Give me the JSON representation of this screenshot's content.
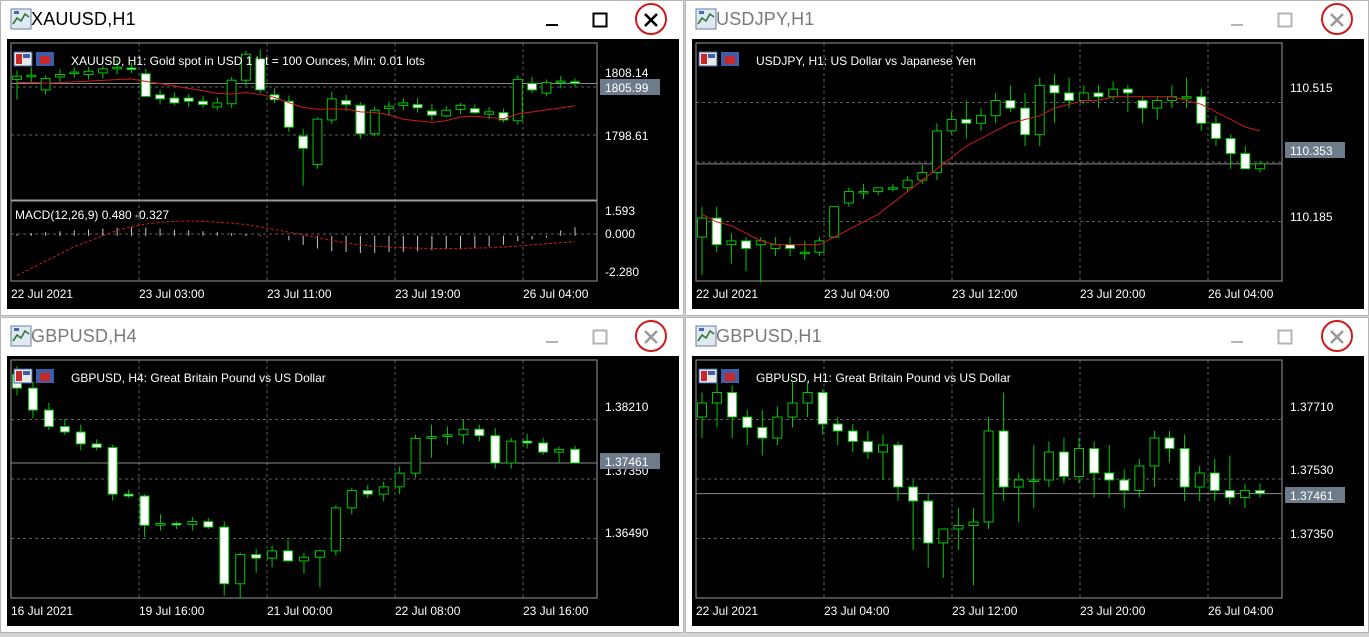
{
  "colors": {
    "chart_bg": "#000000",
    "grid": "#5f5f5f",
    "candle_up": "#00c800",
    "candle_body": "#ffffff",
    "ma_line": "#d01a1a",
    "price_line": "#8c8c8c",
    "price_label_bg": "#6e7b8b",
    "close_ring": "#cc1b1b"
  },
  "icons": {
    "window": "mt4-chart-window-icon",
    "minimize": "minimize-icon",
    "maximize": "maximize-icon",
    "close": "close-icon",
    "chart_badge": "chart-properties-icon"
  },
  "windows": [
    {
      "title": "XAUUSD,H1",
      "active": true,
      "info": "XAUUSD, H1:  Gold spot in USD 1 lot = 100 Ounces, Min: 0.01 lots",
      "price_ticks": [
        "1808.14",
        "1798.61"
      ],
      "current_price": "1805.99",
      "indicator": {
        "label": "MACD(12,26,9) 0.480 -0.327",
        "ticks": [
          "1.593",
          "0.000",
          "-2.280"
        ]
      },
      "time_labels": [
        "22 Jul 2021",
        "23 Jul 03:00",
        "23 Jul 11:00",
        "23 Jul 19:00",
        "26 Jul 04:00"
      ]
    },
    {
      "title": "USDJPY,H1",
      "active": false,
      "info": "USDJPY, H1:  US Dollar vs Japanese Yen",
      "price_ticks": [
        "110.515",
        "110.185"
      ],
      "current_price": "110.353",
      "time_labels": [
        "22 Jul 2021",
        "23 Jul 04:00",
        "23 Jul 12:00",
        "23 Jul 20:00",
        "26 Jul 04:00"
      ]
    },
    {
      "title": "GBPUSD,H4",
      "active": false,
      "info": "GBPUSD, H4:  Great Britain Pound vs US Dollar",
      "price_ticks": [
        "1.38210",
        "1.37350",
        "1.36490"
      ],
      "current_price": "1.37461",
      "time_labels": [
        "16 Jul 2021",
        "19 Jul 16:00",
        "21 Jul 00:00",
        "22 Jul 08:00",
        "23 Jul 16:00"
      ]
    },
    {
      "title": "GBPUSD,H1",
      "active": false,
      "info": "GBPUSD, H1:  Great Britain Pound vs US Dollar",
      "price_ticks": [
        "1.37710",
        "1.37530",
        "1.37350"
      ],
      "current_price": "1.37461",
      "time_labels": [
        "22 Jul 2021",
        "23 Jul 04:00",
        "23 Jul 12:00",
        "23 Jul 20:00",
        "26 Jul 04:00"
      ]
    }
  ],
  "chart_data": [
    {
      "type": "candlestick",
      "symbol": "XAUUSD",
      "timeframe": "H1",
      "ylim": [
        1792,
        1810
      ],
      "ma_period_hint": "moving-average",
      "candles": [
        [
          1806.5,
          1807.6,
          1804.0,
          1806.9
        ],
        [
          1807.0,
          1808.0,
          1806.0,
          1807.0
        ],
        [
          1805.2,
          1807.0,
          1804.6,
          1806.6
        ],
        [
          1806.8,
          1807.8,
          1806.2,
          1807.1
        ],
        [
          1807.3,
          1808.0,
          1806.7,
          1807.4
        ],
        [
          1807.1,
          1808.0,
          1806.5,
          1807.5
        ],
        [
          1807.3,
          1808.2,
          1806.6,
          1807.8
        ],
        [
          1807.8,
          1808.9,
          1807.1,
          1808.0
        ],
        [
          1807.9,
          1808.6,
          1807.3,
          1807.8
        ],
        [
          1807.2,
          1807.8,
          1805.4,
          1804.4
        ],
        [
          1804.6,
          1805.2,
          1803.4,
          1804.1
        ],
        [
          1804.2,
          1804.9,
          1803.3,
          1803.6
        ],
        [
          1804.2,
          1804.7,
          1803.1,
          1803.8
        ],
        [
          1803.8,
          1804.5,
          1803.0,
          1803.4
        ],
        [
          1803.1,
          1804.3,
          1802.7,
          1803.6
        ],
        [
          1803.5,
          1806.8,
          1803.0,
          1806.4
        ],
        [
          1806.4,
          1810.0,
          1805.7,
          1809.6
        ],
        [
          1809.0,
          1810.2,
          1804.8,
          1805.2
        ],
        [
          1804.6,
          1805.4,
          1803.6,
          1804.0
        ],
        [
          1803.8,
          1804.5,
          1800.0,
          1800.6
        ],
        [
          1799.5,
          1800.4,
          1793.4,
          1798.0
        ],
        [
          1796.0,
          1801.8,
          1795.5,
          1801.6
        ],
        [
          1801.5,
          1805.0,
          1801.0,
          1804.1
        ],
        [
          1803.9,
          1804.6,
          1802.6,
          1803.4
        ],
        [
          1803.3,
          1803.7,
          1799.2,
          1799.8
        ],
        [
          1799.8,
          1803.2,
          1799.5,
          1802.7
        ],
        [
          1802.9,
          1803.8,
          1802.0,
          1803.2
        ],
        [
          1803.3,
          1804.2,
          1802.7,
          1803.6
        ],
        [
          1803.4,
          1804.2,
          1802.4,
          1803.0
        ],
        [
          1802.6,
          1803.5,
          1801.4,
          1802.1
        ],
        [
          1802.0,
          1803.2,
          1801.8,
          1802.7
        ],
        [
          1802.8,
          1803.6,
          1802.2,
          1803.3
        ],
        [
          1802.9,
          1803.4,
          1802.2,
          1802.4
        ],
        [
          1802.2,
          1803.1,
          1801.6,
          1802.5
        ],
        [
          1802.4,
          1802.9,
          1801.2,
          1801.5
        ],
        [
          1801.4,
          1807.0,
          1800.9,
          1806.5
        ],
        [
          1806.0,
          1806.8,
          1804.8,
          1805.2
        ],
        [
          1804.8,
          1806.5,
          1804.4,
          1806.1
        ],
        [
          1806.1,
          1806.9,
          1805.4,
          1806.3
        ],
        [
          1806.2,
          1806.6,
          1805.6,
          1805.99
        ]
      ],
      "macd": {
        "ylim": [
          -2.28,
          1.593
        ],
        "hist": [
          0.1,
          0.15,
          0.2,
          0.25,
          0.3,
          0.35,
          0.4,
          0.45,
          0.48,
          0.45,
          0.4,
          0.35,
          0.3,
          0.25,
          0.2,
          0.15,
          0.1,
          0.05,
          0.0,
          -0.25,
          -0.5,
          -0.7,
          -0.85,
          -0.9,
          -0.95,
          -0.95,
          -0.9,
          -0.9,
          -0.85,
          -0.8,
          -0.75,
          -0.75,
          -0.7,
          -0.6,
          -0.5,
          -0.3,
          -0.2,
          -0.1,
          0.3,
          0.48
        ],
        "signal": [
          -2.2,
          -1.8,
          -1.4,
          -1.0,
          -0.6,
          -0.3,
          0.0,
          0.3,
          0.5,
          0.65,
          0.75,
          0.8,
          0.82,
          0.8,
          0.75,
          0.7,
          0.62,
          0.5,
          0.35,
          0.2,
          0.05,
          -0.1,
          -0.25,
          -0.4,
          -0.5,
          -0.58,
          -0.62,
          -0.66,
          -0.68,
          -0.7,
          -0.7,
          -0.7,
          -0.68,
          -0.66,
          -0.62,
          -0.58,
          -0.5,
          -0.44,
          -0.38,
          -0.327
        ]
      }
    },
    {
      "type": "candlestick",
      "symbol": "USDJPY",
      "timeframe": "H1",
      "ylim": [
        110.06,
        110.64
      ],
      "candles": [
        [
          110.16,
          110.24,
          110.06,
          110.21
        ],
        [
          110.21,
          110.24,
          110.12,
          110.14
        ],
        [
          110.14,
          110.17,
          110.09,
          110.15
        ],
        [
          110.15,
          110.16,
          110.07,
          110.13
        ],
        [
          110.14,
          110.16,
          110.04,
          110.15
        ],
        [
          110.13,
          110.16,
          110.11,
          110.14
        ],
        [
          110.14,
          110.16,
          110.11,
          110.13
        ],
        [
          110.12,
          110.15,
          110.1,
          110.12
        ],
        [
          110.12,
          110.16,
          110.11,
          110.15
        ],
        [
          110.16,
          110.24,
          110.16,
          110.24
        ],
        [
          110.25,
          110.29,
          110.24,
          110.28
        ],
        [
          110.28,
          110.3,
          110.26,
          110.28
        ],
        [
          110.28,
          110.29,
          110.27,
          110.29
        ],
        [
          110.29,
          110.3,
          110.28,
          110.29
        ],
        [
          110.29,
          110.32,
          110.28,
          110.31
        ],
        [
          110.31,
          110.35,
          110.3,
          110.33
        ],
        [
          110.33,
          110.46,
          110.31,
          110.44
        ],
        [
          110.44,
          110.49,
          110.43,
          110.47
        ],
        [
          110.47,
          110.52,
          110.42,
          110.46
        ],
        [
          110.46,
          110.5,
          110.44,
          110.48
        ],
        [
          110.48,
          110.54,
          110.46,
          110.52
        ],
        [
          110.52,
          110.56,
          110.49,
          110.5
        ],
        [
          110.5,
          110.54,
          110.4,
          110.43
        ],
        [
          110.43,
          110.58,
          110.4,
          110.56
        ],
        [
          110.56,
          110.59,
          110.46,
          110.54
        ],
        [
          110.54,
          110.58,
          110.5,
          110.52
        ],
        [
          110.52,
          110.56,
          110.51,
          110.54
        ],
        [
          110.54,
          110.56,
          110.5,
          110.53
        ],
        [
          110.53,
          110.57,
          110.52,
          110.55
        ],
        [
          110.55,
          110.56,
          110.49,
          110.54
        ],
        [
          110.52,
          110.53,
          110.46,
          110.5
        ],
        [
          110.5,
          110.53,
          110.47,
          110.52
        ],
        [
          110.52,
          110.56,
          110.5,
          110.53
        ],
        [
          110.53,
          110.58,
          110.5,
          110.53
        ],
        [
          110.53,
          110.55,
          110.44,
          110.46
        ],
        [
          110.46,
          110.48,
          110.4,
          110.42
        ],
        [
          110.42,
          110.43,
          110.34,
          110.38
        ],
        [
          110.38,
          110.4,
          110.34,
          110.34
        ],
        [
          110.34,
          110.36,
          110.33,
          110.353
        ]
      ],
      "ma": [
        110.22,
        110.2,
        110.19,
        110.17,
        110.15,
        110.14,
        110.14,
        110.14,
        110.14,
        110.16,
        110.18,
        110.2,
        110.22,
        110.25,
        110.28,
        110.31,
        110.34,
        110.37,
        110.4,
        110.42,
        110.44,
        110.46,
        110.47,
        110.48,
        110.5,
        110.51,
        110.52,
        110.52,
        110.53,
        110.53,
        110.53,
        110.53,
        110.53,
        110.52,
        110.51,
        110.49,
        110.47,
        110.45,
        110.44
      ]
    },
    {
      "type": "candlestick",
      "symbol": "GBPUSD",
      "timeframe": "H4",
      "ylim": [
        1.3605,
        1.385
      ],
      "candles": [
        [
          1.3843,
          1.3852,
          1.382,
          1.3828
        ],
        [
          1.3828,
          1.3835,
          1.3795,
          1.3804
        ],
        [
          1.3804,
          1.3812,
          1.3782,
          1.3786
        ],
        [
          1.3786,
          1.3794,
          1.3777,
          1.378
        ],
        [
          1.378,
          1.3788,
          1.376,
          1.3767
        ],
        [
          1.3767,
          1.3772,
          1.376,
          1.3763
        ],
        [
          1.3763,
          1.3766,
          1.3705,
          1.3712
        ],
        [
          1.3712,
          1.3717,
          1.3708,
          1.371
        ],
        [
          1.371,
          1.3712,
          1.3665,
          1.3678
        ],
        [
          1.3678,
          1.369,
          1.3672,
          1.368
        ],
        [
          1.368,
          1.3682,
          1.3674,
          1.3679
        ],
        [
          1.3679,
          1.3687,
          1.3672,
          1.3682
        ],
        [
          1.3682,
          1.3686,
          1.3674,
          1.3676
        ],
        [
          1.3676,
          1.3682,
          1.3601,
          1.3614
        ],
        [
          1.3614,
          1.3648,
          1.3598,
          1.3646
        ],
        [
          1.3646,
          1.3652,
          1.3626,
          1.3642
        ],
        [
          1.3642,
          1.3656,
          1.3632,
          1.365
        ],
        [
          1.365,
          1.3662,
          1.3641,
          1.3639
        ],
        [
          1.3639,
          1.3648,
          1.3625,
          1.3643
        ],
        [
          1.3643,
          1.3651,
          1.361,
          1.365
        ],
        [
          1.365,
          1.37,
          1.3645,
          1.3697
        ],
        [
          1.3697,
          1.3719,
          1.369,
          1.3716
        ],
        [
          1.3716,
          1.3722,
          1.3708,
          1.3712
        ],
        [
          1.3712,
          1.3726,
          1.3704,
          1.372
        ],
        [
          1.372,
          1.3742,
          1.3712,
          1.3735
        ],
        [
          1.3735,
          1.3777,
          1.373,
          1.3773
        ],
        [
          1.3773,
          1.3788,
          1.3752,
          1.3775
        ],
        [
          1.3775,
          1.3786,
          1.3766,
          1.3777
        ],
        [
          1.3777,
          1.3794,
          1.3767,
          1.3783
        ],
        [
          1.3783,
          1.3788,
          1.377,
          1.3776
        ],
        [
          1.3776,
          1.3784,
          1.374,
          1.3746
        ],
        [
          1.3746,
          1.3774,
          1.374,
          1.377
        ],
        [
          1.377,
          1.3778,
          1.3762,
          1.3768
        ],
        [
          1.3768,
          1.3774,
          1.3755,
          1.3758
        ],
        [
          1.3758,
          1.3764,
          1.3746,
          1.3761
        ],
        [
          1.3761,
          1.3765,
          1.375,
          1.37461
        ]
      ]
    },
    {
      "type": "candlestick",
      "symbol": "GBPUSD",
      "timeframe": "H1",
      "ylim": [
        1.3718,
        1.3782
      ],
      "candles": [
        [
          1.3768,
          1.3775,
          1.3762,
          1.3772
        ],
        [
          1.3772,
          1.3778,
          1.3765,
          1.3775
        ],
        [
          1.3775,
          1.3777,
          1.3762,
          1.3768
        ],
        [
          1.3768,
          1.377,
          1.376,
          1.3765
        ],
        [
          1.3765,
          1.377,
          1.3757,
          1.3762
        ],
        [
          1.3762,
          1.3771,
          1.376,
          1.3768
        ],
        [
          1.3768,
          1.3778,
          1.3765,
          1.3772
        ],
        [
          1.3772,
          1.3778,
          1.3768,
          1.3775
        ],
        [
          1.3775,
          1.3776,
          1.3763,
          1.3766
        ],
        [
          1.3766,
          1.3768,
          1.376,
          1.3764
        ],
        [
          1.3764,
          1.3766,
          1.3758,
          1.3761
        ],
        [
          1.3761,
          1.3764,
          1.3756,
          1.3758
        ],
        [
          1.3758,
          1.3763,
          1.375,
          1.376
        ],
        [
          1.376,
          1.3761,
          1.3744,
          1.3748
        ],
        [
          1.3748,
          1.375,
          1.373,
          1.3744
        ],
        [
          1.3744,
          1.3746,
          1.3725,
          1.3732
        ],
        [
          1.3732,
          1.3736,
          1.3722,
          1.3736
        ],
        [
          1.3736,
          1.3742,
          1.373,
          1.3737
        ],
        [
          1.3737,
          1.3742,
          1.372,
          1.3738
        ],
        [
          1.3738,
          1.3768,
          1.3736,
          1.3764
        ],
        [
          1.3764,
          1.3775,
          1.3744,
          1.3748
        ],
        [
          1.3748,
          1.3752,
          1.3738,
          1.375
        ],
        [
          1.375,
          1.376,
          1.3742,
          1.375
        ],
        [
          1.375,
          1.3761,
          1.3748,
          1.3758
        ],
        [
          1.3758,
          1.3762,
          1.3749,
          1.3751
        ],
        [
          1.3751,
          1.3762,
          1.3749,
          1.3759
        ],
        [
          1.3759,
          1.3761,
          1.3745,
          1.3752
        ],
        [
          1.3752,
          1.376,
          1.3745,
          1.375
        ],
        [
          1.375,
          1.3753,
          1.3742,
          1.3747
        ],
        [
          1.3747,
          1.3756,
          1.3745,
          1.3754
        ],
        [
          1.3754,
          1.3764,
          1.3748,
          1.3762
        ],
        [
          1.3762,
          1.3764,
          1.3755,
          1.3759
        ],
        [
          1.3759,
          1.3763,
          1.3744,
          1.3748
        ],
        [
          1.3748,
          1.3754,
          1.3744,
          1.3752
        ],
        [
          1.3752,
          1.3756,
          1.3744,
          1.3747
        ],
        [
          1.3747,
          1.3757,
          1.3743,
          1.3745
        ],
        [
          1.3745,
          1.3749,
          1.3742,
          1.3747
        ],
        [
          1.3747,
          1.3749,
          1.3745,
          1.37461
        ]
      ]
    }
  ]
}
